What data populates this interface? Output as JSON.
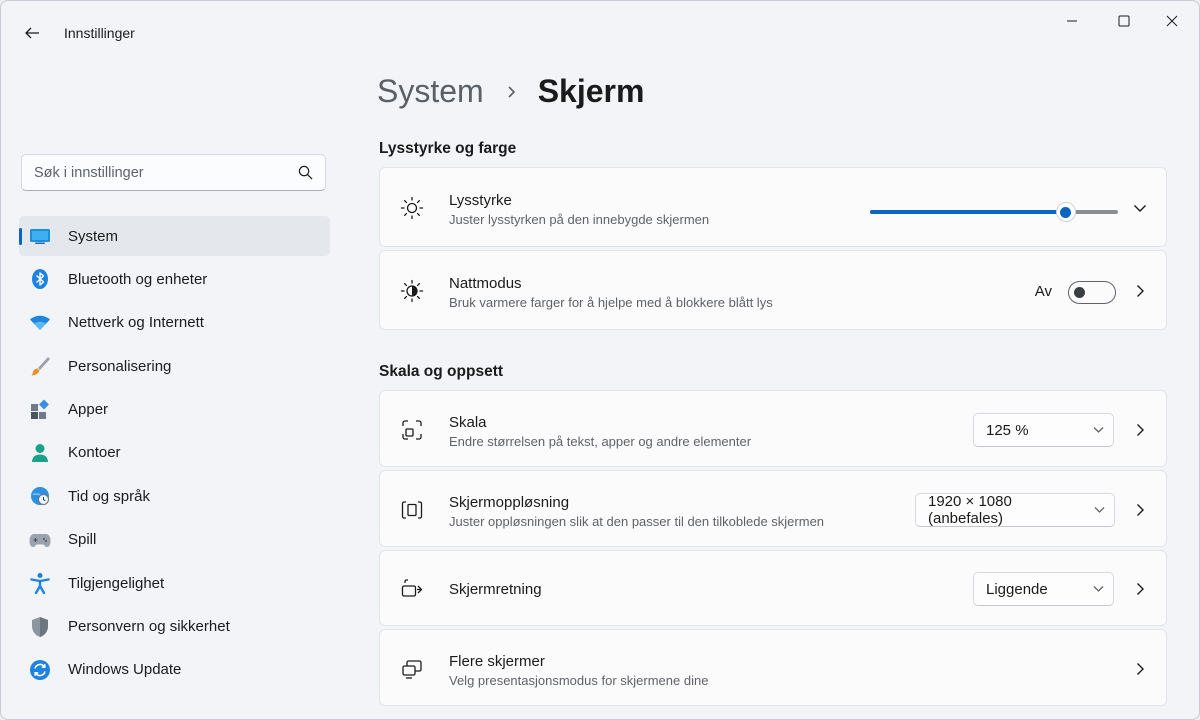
{
  "window": {
    "title": "Innstillinger",
    "controls": {
      "minimize": "minimize-icon",
      "maximize": "maximize-icon",
      "close": "close-icon"
    }
  },
  "sidebar": {
    "search": {
      "placeholder": "Søk i innstillinger",
      "value": ""
    },
    "items": [
      {
        "label": "System",
        "icon": "monitor-icon",
        "active": true
      },
      {
        "label": "Bluetooth og enheter",
        "icon": "bluetooth-icon"
      },
      {
        "label": "Nettverk og Internett",
        "icon": "wifi-icon"
      },
      {
        "label": "Personalisering",
        "icon": "brush-icon"
      },
      {
        "label": "Apper",
        "icon": "apps-icon"
      },
      {
        "label": "Kontoer",
        "icon": "account-icon"
      },
      {
        "label": "Tid og språk",
        "icon": "globe-clock-icon"
      },
      {
        "label": "Spill",
        "icon": "gamepad-icon"
      },
      {
        "label": "Tilgjengelighet",
        "icon": "accessibility-icon"
      },
      {
        "label": "Personvern og sikkerhet",
        "icon": "shield-icon"
      },
      {
        "label": "Windows Update",
        "icon": "update-icon"
      }
    ]
  },
  "main": {
    "breadcrumb": {
      "parent": "System",
      "current": "Skjerm"
    },
    "sections": [
      {
        "title": "Lysstyrke og farge"
      },
      {
        "title": "Skala og oppsett"
      }
    ],
    "brightness": {
      "title": "Lysstyrke",
      "subtitle": "Juster lysstyrken på den innebygde skjermen",
      "level": 0.79
    },
    "night_mode": {
      "title": "Nattmodus",
      "subtitle": "Bruk varmere farger for å hjelpe med å blokkere blått lys",
      "state_label": "Av",
      "on": false
    },
    "scale": {
      "title": "Skala",
      "subtitle": "Endre størrelsen på tekst, apper og andre elementer",
      "value": "125 %"
    },
    "resolution": {
      "title": "Skjermoppløsning",
      "subtitle": "Juster oppløsningen slik at den passer til den tilkoblede skjermen",
      "value": "1920 × 1080 (anbefales)"
    },
    "orientation": {
      "title": "Skjermretning",
      "value": "Liggende"
    },
    "multiple_displays": {
      "title": "Flere skjermer",
      "subtitle": "Velg presentasjonsmodus for skjermene dine"
    }
  },
  "colors": {
    "accent": "#0a64c0",
    "window_bg": "#f2f4f8",
    "card_bg": "#fbfbfc"
  }
}
